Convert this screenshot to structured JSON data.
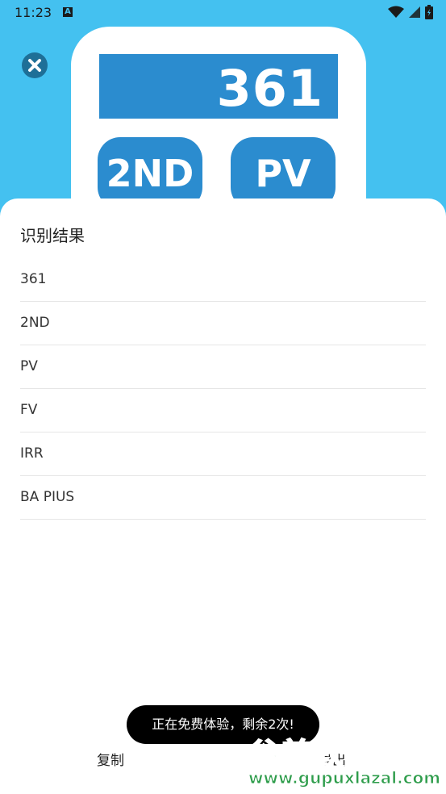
{
  "status_bar": {
    "time": "11:23",
    "notification_badge": "A",
    "icons": [
      "wifi-icon",
      "signal-icon",
      "battery-icon"
    ]
  },
  "camera_preview": {
    "display_value": "361",
    "keys": [
      "2ND",
      "PV"
    ]
  },
  "sheet": {
    "title": "识别结果",
    "results": [
      "361",
      "2ND",
      "PV",
      "FV",
      "IRR",
      "BA PIUS"
    ]
  },
  "actions": {
    "copy_label": "复制",
    "export_label": "导出"
  },
  "toast": {
    "message": "正在免费体验，剩余2次!"
  },
  "watermark": {
    "title": "谷普软件园",
    "url": "www.gupuxlazal.com"
  },
  "colors": {
    "background": "#44c1f0",
    "accent": "#2b8ccf",
    "watermark_green": "#2f9d4c"
  }
}
